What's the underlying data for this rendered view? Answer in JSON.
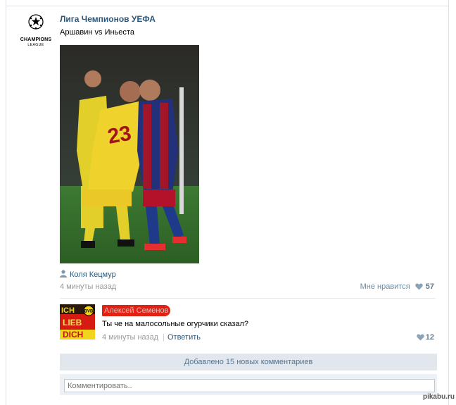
{
  "post": {
    "author": "Лига Чемпионов УЕФА",
    "logo": {
      "line1": "CHAMPIONS",
      "line2": "LEAGUE"
    },
    "text": "Аршавин vs Иньеста",
    "photo_alt": "Фото",
    "signer": "Коля Кецмур",
    "time": "4 минуты назад",
    "likes_label": "Мне нравится",
    "likes_count": "57"
  },
  "comment": {
    "avatar_text": [
      "ICH",
      "LIEB",
      "DICH"
    ],
    "avatar_badge": "BVB",
    "author": "Алексей Семенов",
    "text": "Ты че на малосольные огурчики сказал?",
    "time": "4 минуты назад",
    "reply_label": "Ответить",
    "likes_count": "12"
  },
  "more_comments": "Добавлено 15 новых комментариев",
  "comment_input": {
    "placeholder": "Комментировать.."
  },
  "watermark": "pikabu.ru",
  "colors": {
    "link": "#2b587a",
    "muted": "#999999",
    "panel": "#e1e7ed",
    "name_highlight": "#e02114"
  }
}
